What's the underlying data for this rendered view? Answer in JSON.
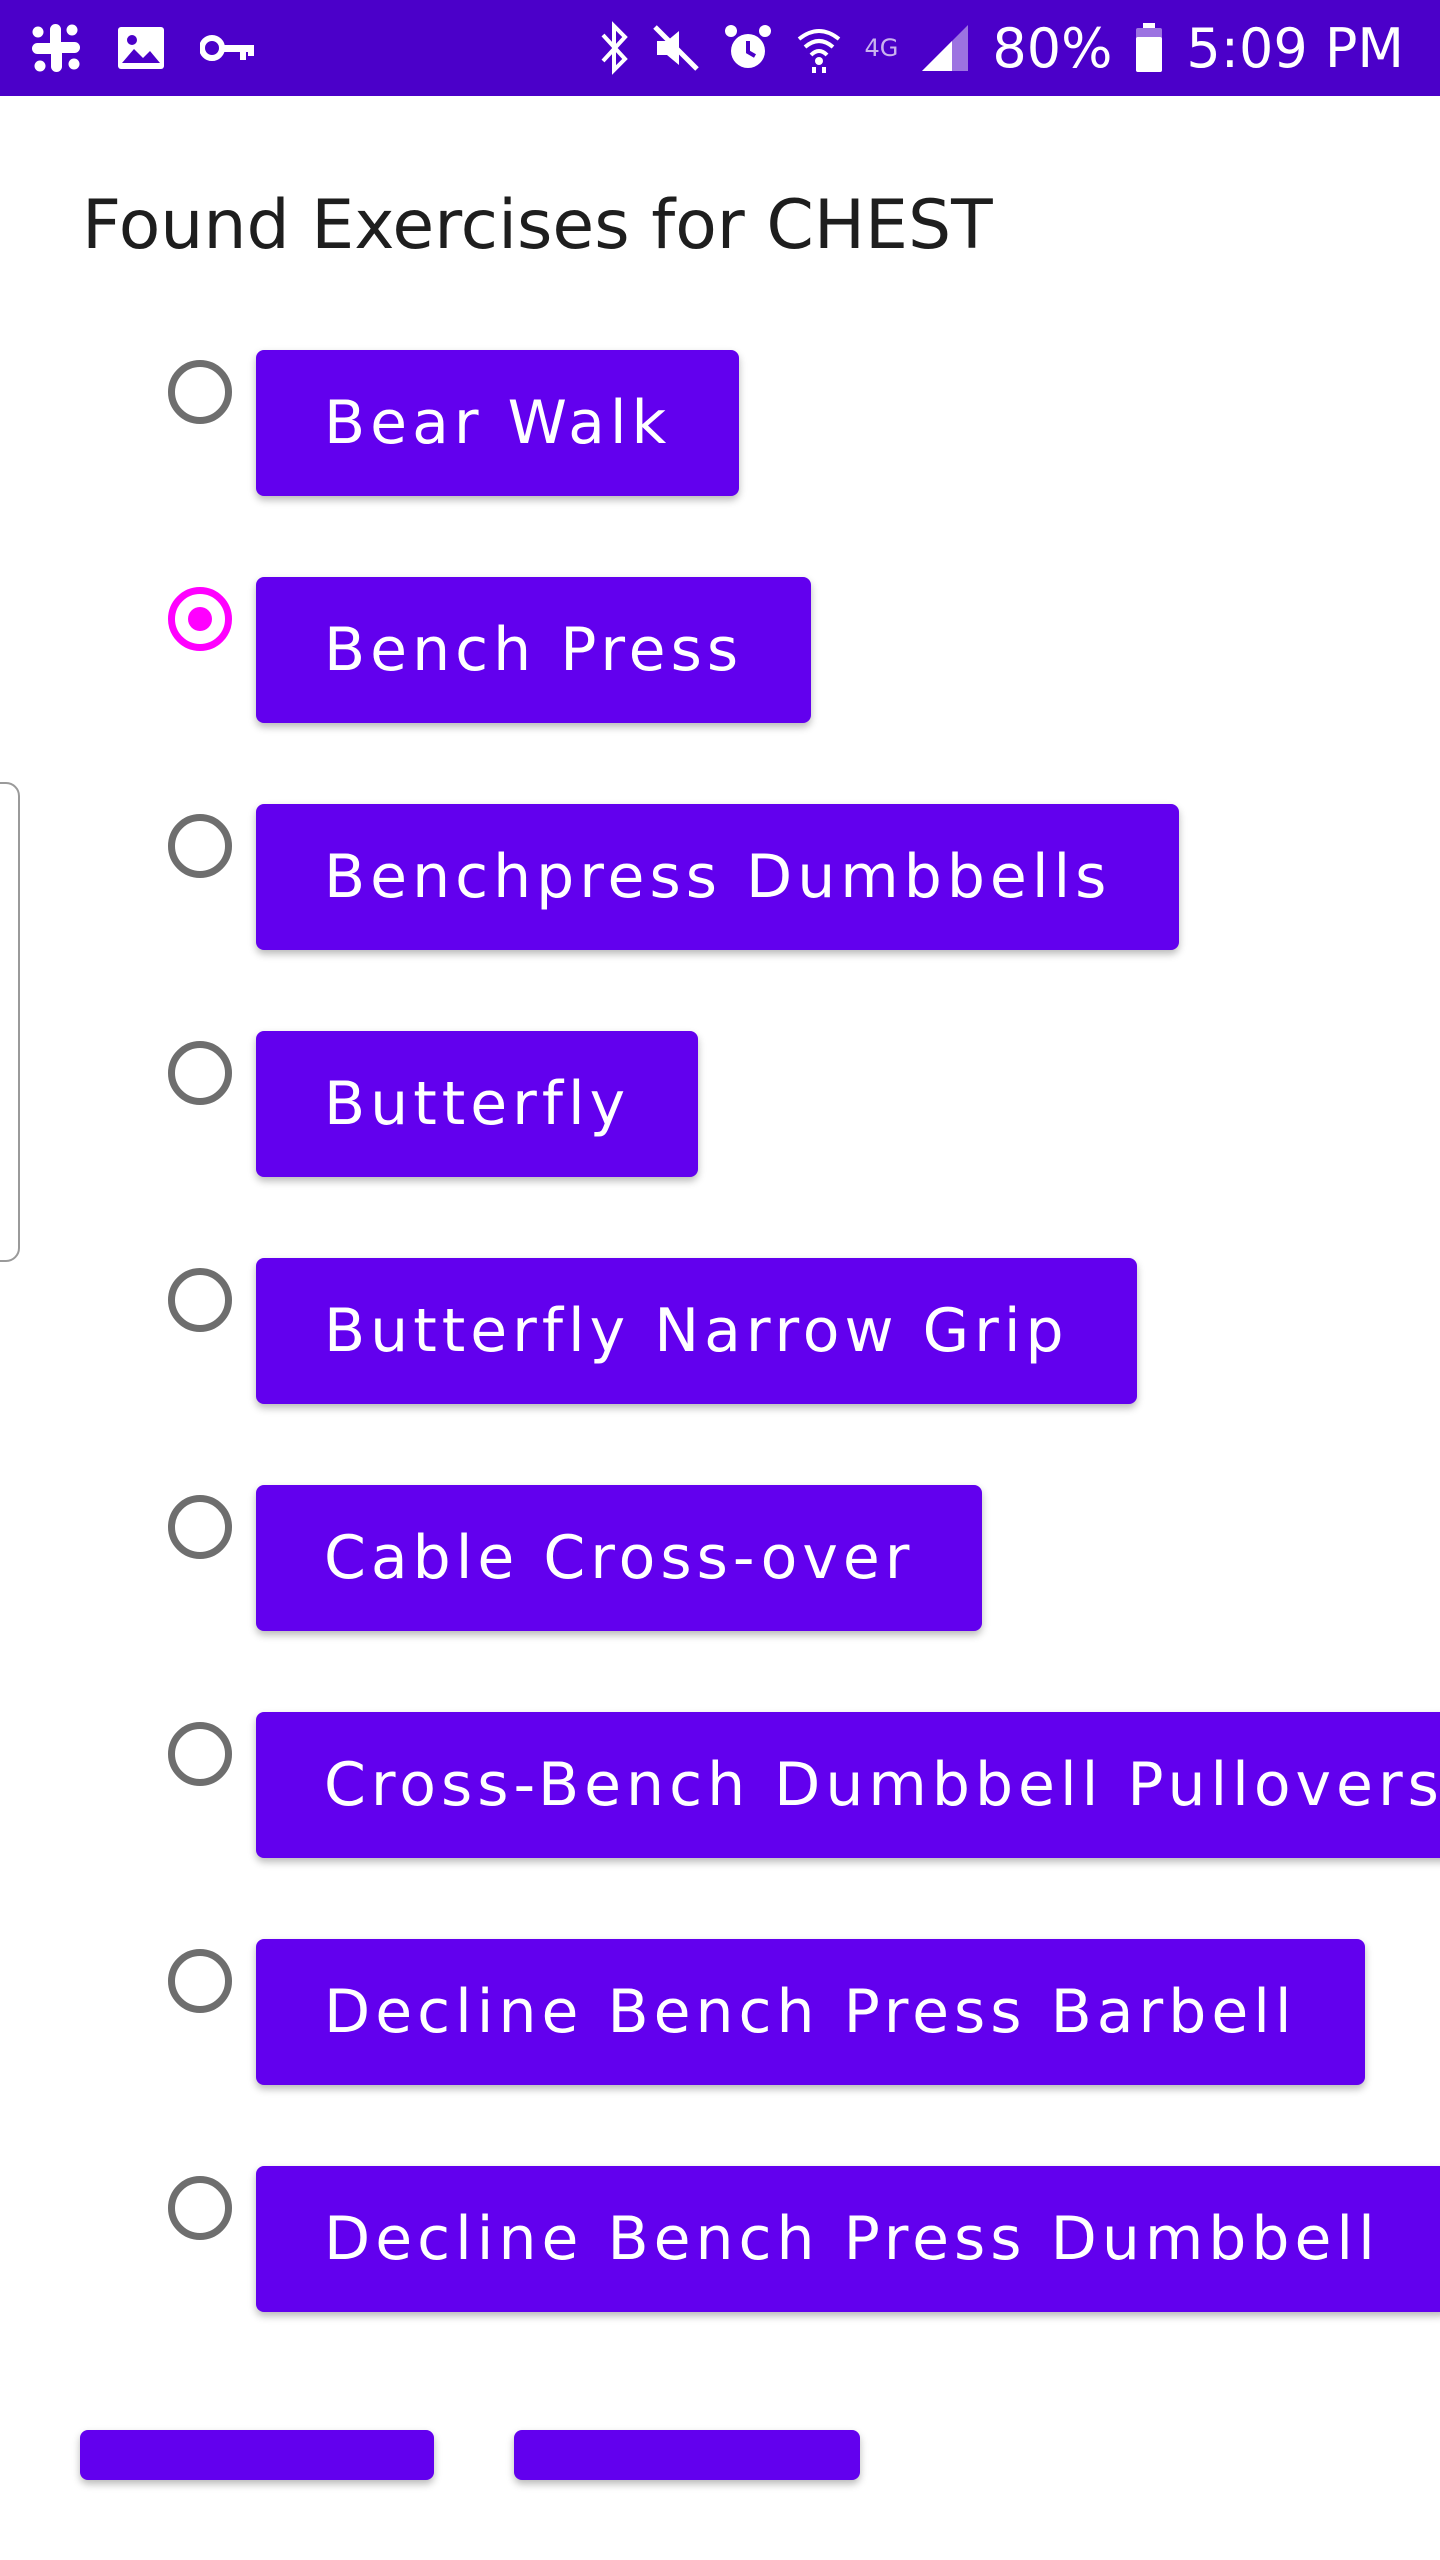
{
  "status_bar": {
    "left_icons": [
      "slack-icon",
      "image-icon",
      "key-icon"
    ],
    "right_icons": [
      "bluetooth-icon",
      "mute-icon",
      "alarm-icon",
      "wifi-icon",
      "lte-icon",
      "signal-icon",
      "battery-icon"
    ],
    "network_label": "4G",
    "battery": "80%",
    "time": "5:09 PM",
    "background_color": "#4b00c9"
  },
  "page": {
    "title": "Found Exercises for CHEST"
  },
  "exercises": [
    {
      "label": "Bear Walk",
      "selected": false
    },
    {
      "label": "Bench Press",
      "selected": true
    },
    {
      "label": "Benchpress Dumbbells",
      "selected": false
    },
    {
      "label": "Butterfly",
      "selected": false
    },
    {
      "label": "Butterfly Narrow Grip",
      "selected": false
    },
    {
      "label": "Cable Cross-over",
      "selected": false
    },
    {
      "label": "Cross-Bench Dumbbell Pullovers",
      "selected": false
    },
    {
      "label": "Decline Bench Press Barbell",
      "selected": false
    },
    {
      "label": "Decline Bench Press Dumbbell",
      "selected": false
    }
  ],
  "colors": {
    "button": "#6200ee",
    "radio_selected": "#ff00ff",
    "radio_unselected": "#6e6e6e"
  }
}
